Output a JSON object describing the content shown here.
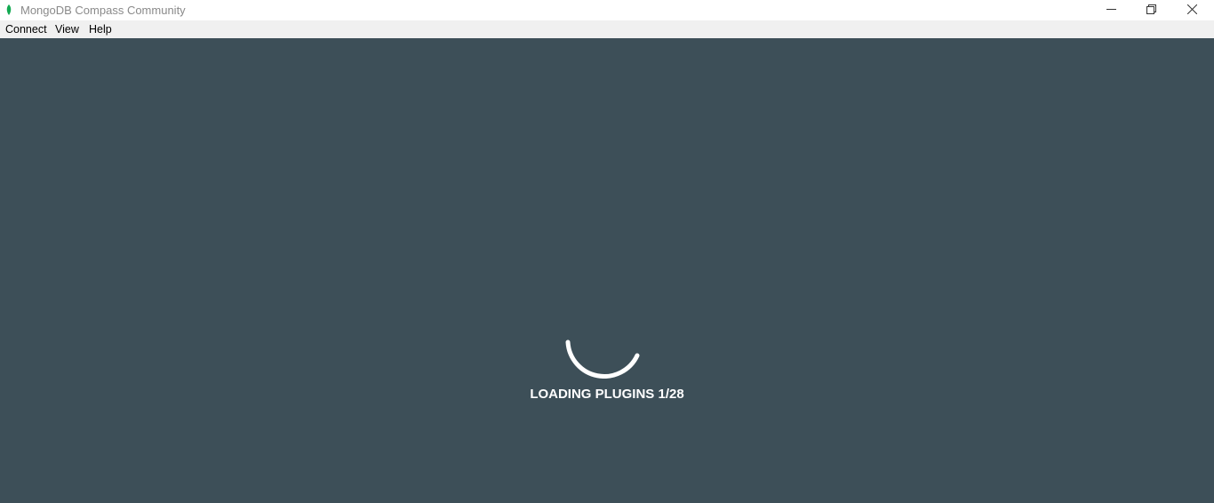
{
  "window": {
    "title": "MongoDB Compass Community",
    "icon": "mongodb-leaf-icon",
    "controls": {
      "minimize_icon": "minimize-icon",
      "maximize_icon": "restore-icon",
      "close_icon": "close-icon"
    }
  },
  "menubar": {
    "items": [
      {
        "label": "Connect"
      },
      {
        "label": "View"
      },
      {
        "label": "Help"
      }
    ]
  },
  "loading": {
    "message": "LOADING PLUGINS 1/28",
    "spinner_icon": "loading-spinner-icon"
  },
  "colors": {
    "background": "#3d4f58",
    "leaf": "#13aa52",
    "text": "#ffffff"
  }
}
